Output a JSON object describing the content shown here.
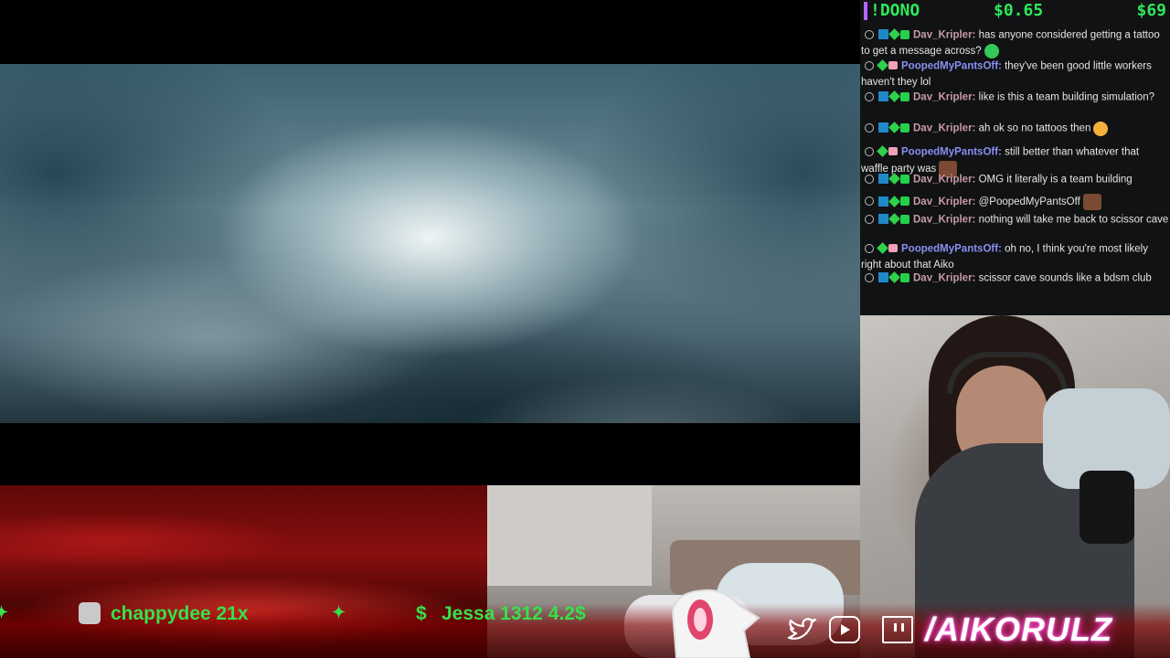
{
  "donation_bar": {
    "command": "!DONO",
    "amount": "$0.65",
    "goal": "$69"
  },
  "chat": {
    "messages": [
      {
        "user": "Dav_Kripler:",
        "user_color": "#c89ba3",
        "text": "has anyone considered getting a tattoo to get a message across?",
        "badges": [
          "prime",
          "star",
          "gift"
        ],
        "emote": "green"
      },
      {
        "user": "PoopedMyPantsOff:",
        "user_color": "#8a8ff2",
        "text": "they've been good little workers haven't they lol",
        "badges": [
          "star",
          "heart"
        ],
        "emote": ""
      },
      {
        "user": "Dav_Kripler:",
        "user_color": "#c89ba3",
        "text": "like is this a team building simulation?",
        "badges": [
          "prime",
          "star",
          "gift"
        ],
        "emote": ""
      },
      {
        "user": "Dav_Kripler:",
        "user_color": "#c89ba3",
        "text": "ah ok so no tattoos then",
        "badges": [
          "prime",
          "star",
          "gift"
        ],
        "emote": "smile"
      },
      {
        "user": "PoopedMyPantsOff:",
        "user_color": "#8a8ff2",
        "text": "still better than whatever that waffle party was",
        "badges": [
          "star",
          "heart"
        ],
        "emote": "face"
      },
      {
        "user": "Dav_Kripler:",
        "user_color": "#c89ba3",
        "text": "OMG it literally is a team building",
        "badges": [
          "prime",
          "star",
          "gift"
        ],
        "emote": ""
      },
      {
        "user": "Dav_Kripler:",
        "user_color": "#c89ba3",
        "text": "@PoopedMyPantsOff",
        "badges": [
          "prime",
          "star",
          "gift"
        ],
        "emote": "face"
      },
      {
        "user": "Dav_Kripler:",
        "user_color": "#c89ba3",
        "text": "nothing will take me back to scissor cave",
        "badges": [
          "prime",
          "star",
          "gift"
        ],
        "emote": ""
      },
      {
        "user": "PoopedMyPantsOff:",
        "user_color": "#8a8ff2",
        "text": "oh no, I think you're most likely right about that Aiko",
        "badges": [
          "star",
          "heart"
        ],
        "emote": ""
      },
      {
        "user": "Dav_Kripler:",
        "user_color": "#c89ba3",
        "text": "scissor cave sounds like a bdsm club",
        "badges": [
          "prime",
          "star",
          "gift"
        ],
        "emote": ""
      }
    ]
  },
  "ticker": {
    "item1_name": "chappydee 21x",
    "item2_prefix": "$",
    "item2_text": "Jessa  1312 4.2$",
    "sparkle": "✦"
  },
  "socials": {
    "icons": [
      "twitter-icon",
      "youtube-icon",
      "twitch-icon"
    ],
    "handle": "/AIKORULZ"
  },
  "colors": {
    "accent_green": "#38e04a",
    "dono_purple": "#b366ff",
    "handle_glow": "#ff4fd8"
  }
}
